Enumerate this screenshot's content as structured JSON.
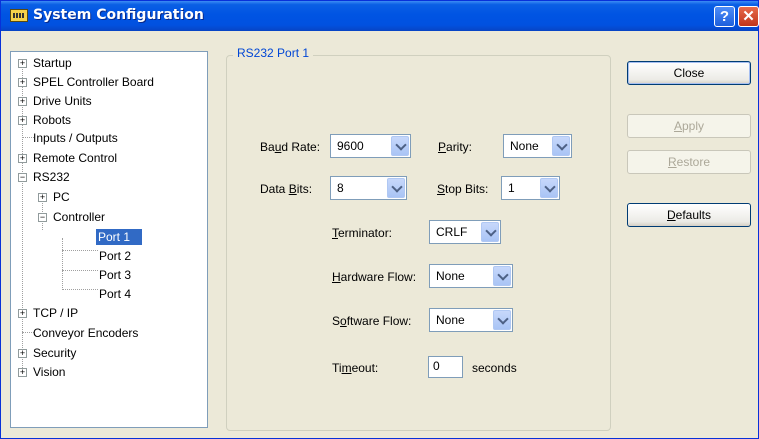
{
  "window": {
    "title": "System Configuration",
    "help_glyph": "?",
    "close_glyph": "✕"
  },
  "tree": {
    "expand_glyph": "+",
    "collapse_glyph": "−",
    "items": [
      {
        "label": "Startup",
        "state": "collapsed"
      },
      {
        "label": "SPEL Controller Board",
        "state": "collapsed"
      },
      {
        "label": "Drive Units",
        "state": "collapsed"
      },
      {
        "label": "Robots",
        "state": "collapsed"
      },
      {
        "label": "Inputs / Outputs",
        "state": "leaf"
      },
      {
        "label": "Remote Control",
        "state": "collapsed"
      },
      {
        "label": "RS232",
        "state": "expanded"
      },
      {
        "label": "PC",
        "state": "collapsed"
      },
      {
        "label": "Controller",
        "state": "expanded"
      },
      {
        "label": "Port 1",
        "state": "leaf",
        "selected": true
      },
      {
        "label": "Port 2",
        "state": "leaf"
      },
      {
        "label": "Port 3",
        "state": "leaf"
      },
      {
        "label": "Port 4",
        "state": "leaf"
      },
      {
        "label": "TCP / IP",
        "state": "collapsed"
      },
      {
        "label": "Conveyor Encoders",
        "state": "leaf"
      },
      {
        "label": "Security",
        "state": "collapsed"
      },
      {
        "label": "Vision",
        "state": "collapsed"
      }
    ]
  },
  "group": {
    "title": "RS232 Port 1",
    "baud_rate": {
      "pre": "Ba",
      "acc": "u",
      "post": "d Rate:",
      "value": "9600"
    },
    "parity": {
      "pre": "",
      "acc": "P",
      "post": "arity:",
      "value": "None"
    },
    "data_bits": {
      "pre": "Data ",
      "acc": "B",
      "post": "its:",
      "value": "8"
    },
    "stop_bits": {
      "pre": "",
      "acc": "S",
      "post": "top Bits:",
      "value": "1"
    },
    "terminator": {
      "pre": "",
      "acc": "T",
      "post": "erminator:",
      "value": "CRLF"
    },
    "hardware_flow": {
      "pre": "",
      "acc": "H",
      "post": "ardware Flow:",
      "value": "None"
    },
    "software_flow": {
      "pre": "S",
      "acc": "o",
      "post": "ftware Flow:",
      "value": "None"
    },
    "timeout": {
      "pre": "Ti",
      "acc": "m",
      "post": "eout:",
      "value": "0",
      "unit": "seconds"
    }
  },
  "buttons": {
    "close": {
      "pre": "Close",
      "acc": "",
      "post": ""
    },
    "apply": {
      "pre": "",
      "acc": "A",
      "post": "pply"
    },
    "restore": {
      "pre": "",
      "acc": "R",
      "post": "estore"
    },
    "defaults": {
      "pre": "",
      "acc": "D",
      "post": "efaults"
    }
  }
}
